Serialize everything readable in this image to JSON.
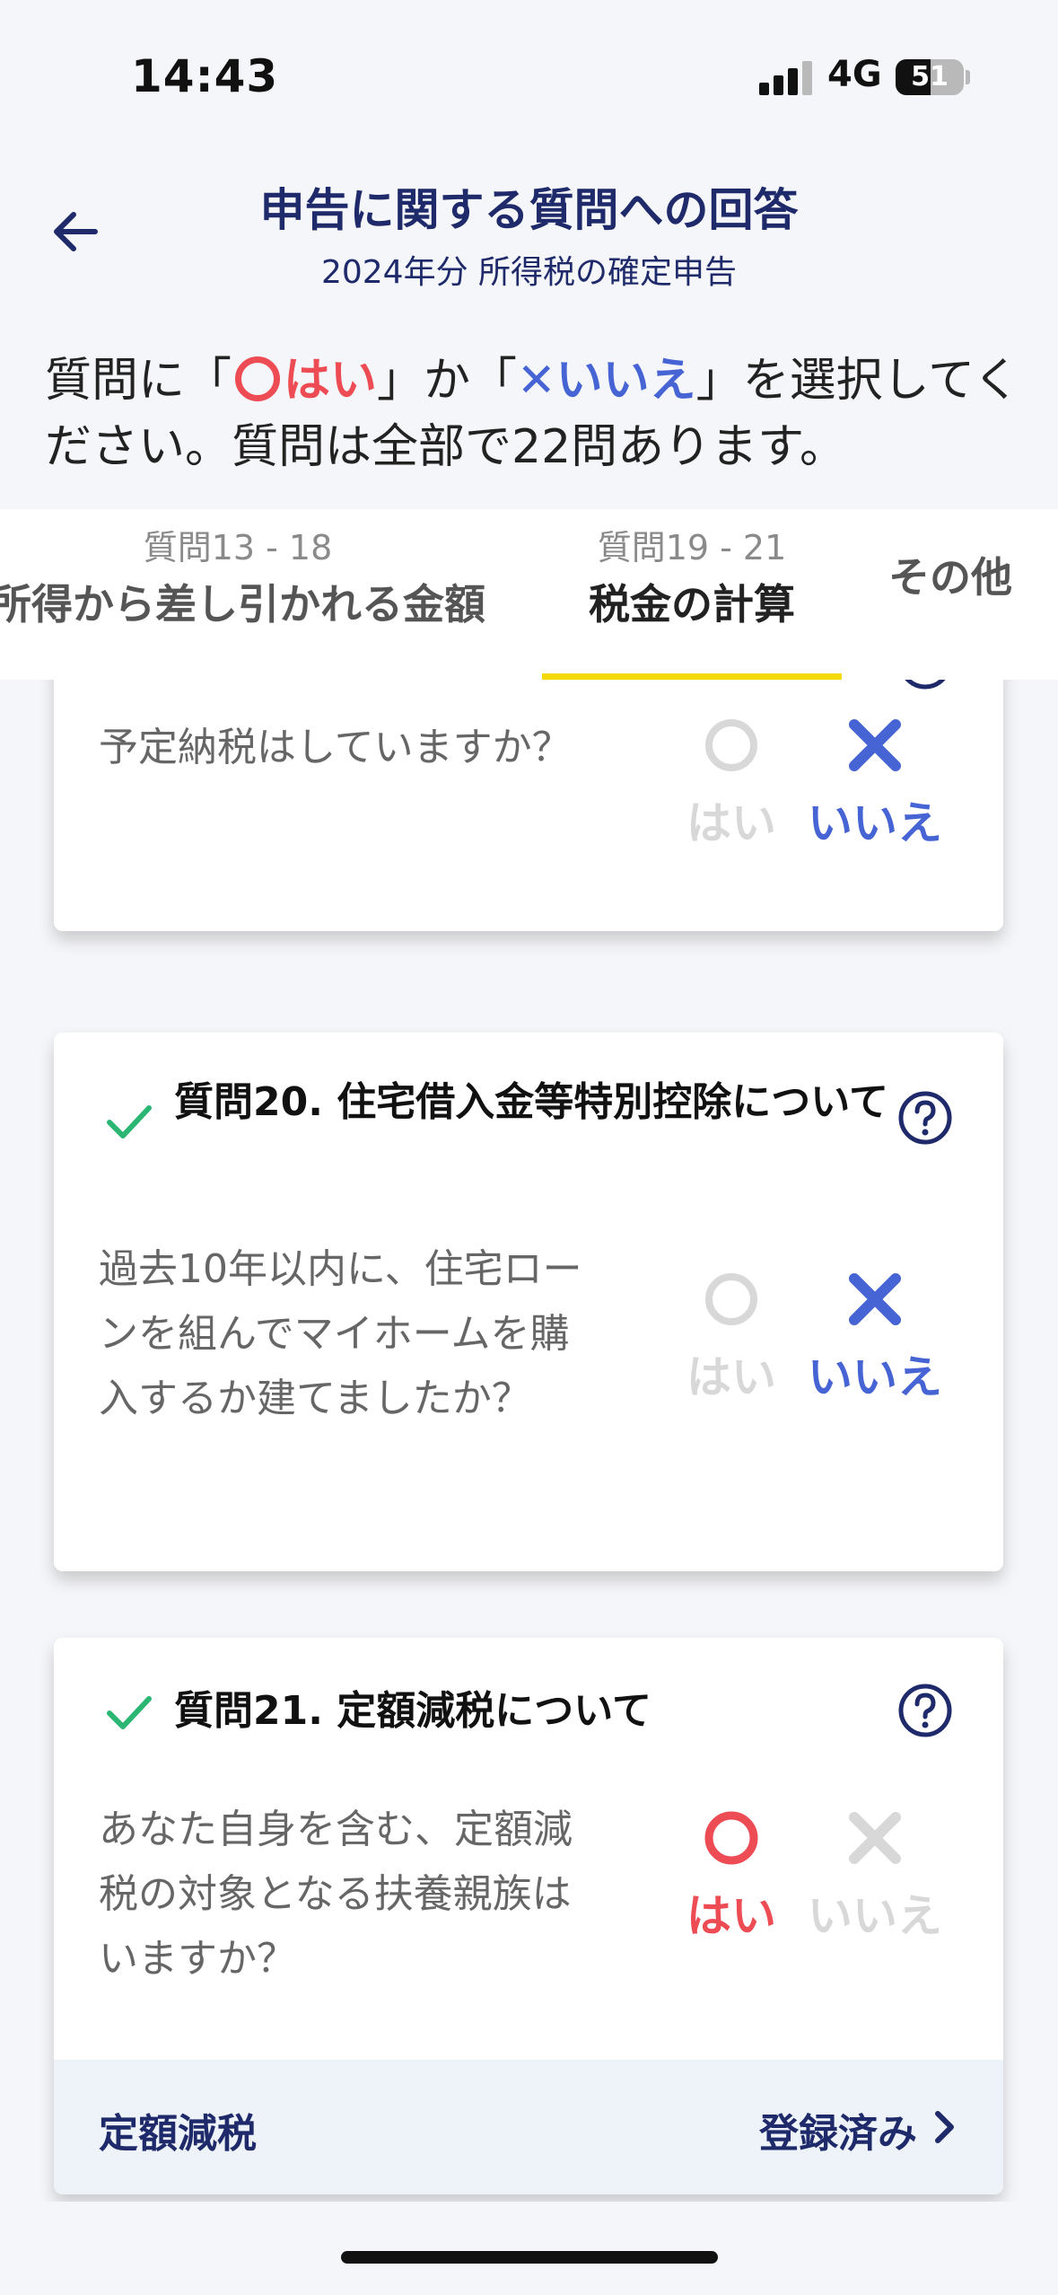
{
  "status_bar": {
    "time": "14:43",
    "network": "4G",
    "battery": "51",
    "battery_level": 0.51
  },
  "header": {
    "title": "申告に関する質問への回答",
    "subtitle": "2024年分 所得税の確定申告"
  },
  "instruction": {
    "part1": "質問に「",
    "yes_label": "はい",
    "part2": "」か「",
    "no_glyph": "✕",
    "no_label": "いいえ",
    "part3": "」を選択してください。質問は全部で22問あります。"
  },
  "tabs": [
    {
      "sub": "質問13 - 18",
      "label": "所得から差し引かれる金額"
    },
    {
      "sub": "質問19 - 21",
      "label": "税金の計算"
    },
    {
      "sub": "",
      "label": "その他"
    }
  ],
  "cards": [
    {
      "question": "予定納税はしていますか？",
      "yes_label": "はい",
      "no_label": "いいえ",
      "selected": "no"
    },
    {
      "title": "質問20. 住宅借入金等特別控除について",
      "question": "過去10年以内に、住宅ローンを組んでマイホームを購入するか建てましたか？",
      "yes_label": "はい",
      "no_label": "いいえ",
      "selected": "no"
    },
    {
      "title": "質問21. 定額減税について",
      "question": "あなた自身を含む、定額減税の対象となる扶養親族はいますか？",
      "yes_label": "はい",
      "no_label": "いいえ",
      "selected": "yes",
      "footer_label": "定額減税",
      "footer_status": "登録済み"
    }
  ],
  "colors": {
    "navy": "#1f2a6b",
    "yes_red": "#ee4c54",
    "no_blue": "#4664d4",
    "check_green": "#2bb673",
    "tab_underline": "#f5d90a",
    "dim": "#d8d8d8"
  }
}
